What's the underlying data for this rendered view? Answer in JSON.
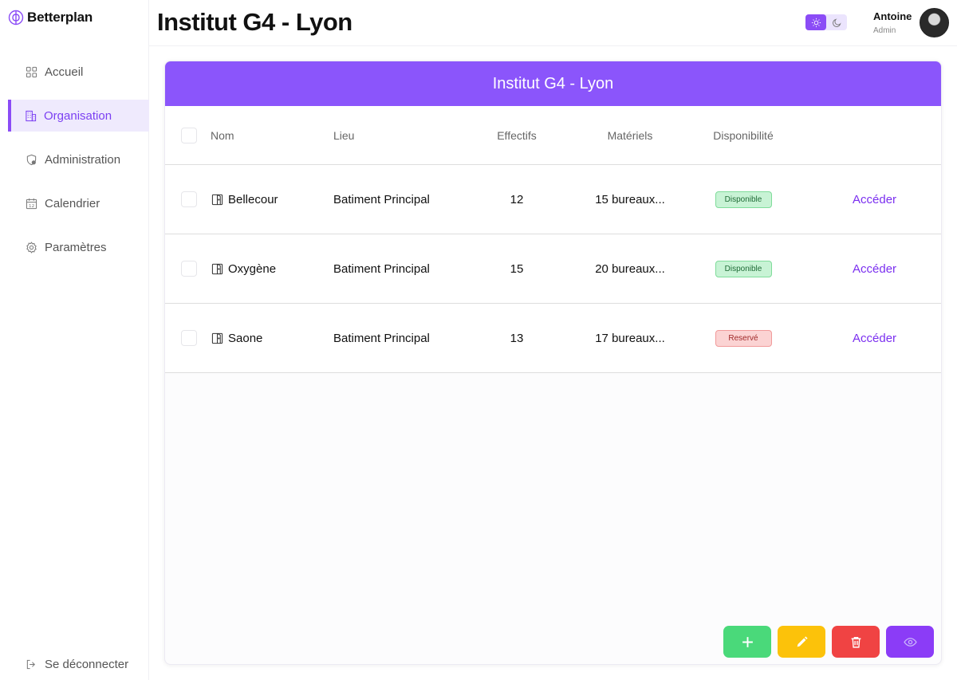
{
  "brand": {
    "name": "Betterplan",
    "accent": "#8b4cf6"
  },
  "sidebar": {
    "items": [
      {
        "label": "Accueil",
        "icon": "grid-icon"
      },
      {
        "label": "Organisation",
        "icon": "building-icon",
        "active": true
      },
      {
        "label": "Administration",
        "icon": "shield-icon"
      },
      {
        "label": "Calendrier",
        "icon": "calendar-icon"
      },
      {
        "label": "Paramètres",
        "icon": "gear-icon"
      }
    ],
    "logout_label": "Se déconnecter"
  },
  "header": {
    "title": "Institut G4 - Lyon",
    "user": {
      "name": "Antoine",
      "role": "Admin"
    }
  },
  "card": {
    "title": "Institut G4 - Lyon",
    "columns": [
      "Nom",
      "Lieu",
      "Effectifs",
      "Matériels",
      "Disponibilité"
    ],
    "rows": [
      {
        "name": "Bellecour",
        "place": "Batiment Principal",
        "staff": "12",
        "equipment": "15 bureaux...",
        "status": "Disponible",
        "status_type": "ok",
        "link": "Accéder"
      },
      {
        "name": "Oxygène",
        "place": "Batiment Principal",
        "staff": "15",
        "equipment": "20 bureaux...",
        "status": "Disponible",
        "status_type": "ok",
        "link": "Accéder"
      },
      {
        "name": "Saone",
        "place": "Batiment Principal",
        "staff": "13",
        "equipment": "17 bureaux...",
        "status": "Reservé",
        "status_type": "no",
        "link": "Accéder"
      }
    ]
  },
  "actions": [
    {
      "name": "add-button",
      "icon": "plus-icon",
      "color": "#4ad97a"
    },
    {
      "name": "edit-button",
      "icon": "pencil-icon",
      "color": "#fcc20a"
    },
    {
      "name": "delete-button",
      "icon": "trash-icon",
      "color": "#f04343"
    },
    {
      "name": "view-button",
      "icon": "eye-icon",
      "color": "#8b3cf7"
    }
  ]
}
